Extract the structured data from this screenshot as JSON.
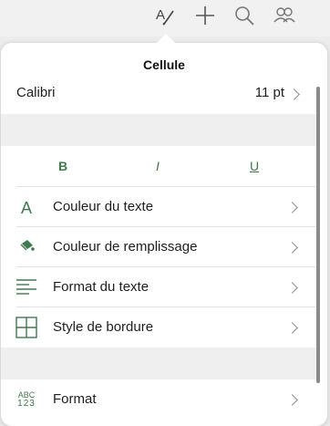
{
  "toolbar": {
    "icons": [
      "format-brush-icon",
      "plus-icon",
      "search-icon",
      "people-icon"
    ]
  },
  "popover": {
    "title": "Cellule",
    "font": {
      "name": "Calibri",
      "size": "11 pt"
    },
    "styles": {
      "bold": "B",
      "italic": "I",
      "underline": "U"
    },
    "menu": [
      {
        "label": "Couleur du texte",
        "icon": "text-color-icon"
      },
      {
        "label": "Couleur de remplissage",
        "icon": "fill-bucket-icon"
      },
      {
        "label": "Format du texte",
        "icon": "text-align-icon"
      },
      {
        "label": "Style de bordure",
        "icon": "border-grid-icon"
      }
    ],
    "format": {
      "label": "Format",
      "icon_top": "ABC",
      "icon_bottom": "123"
    },
    "accent": "#3f7a4e"
  }
}
